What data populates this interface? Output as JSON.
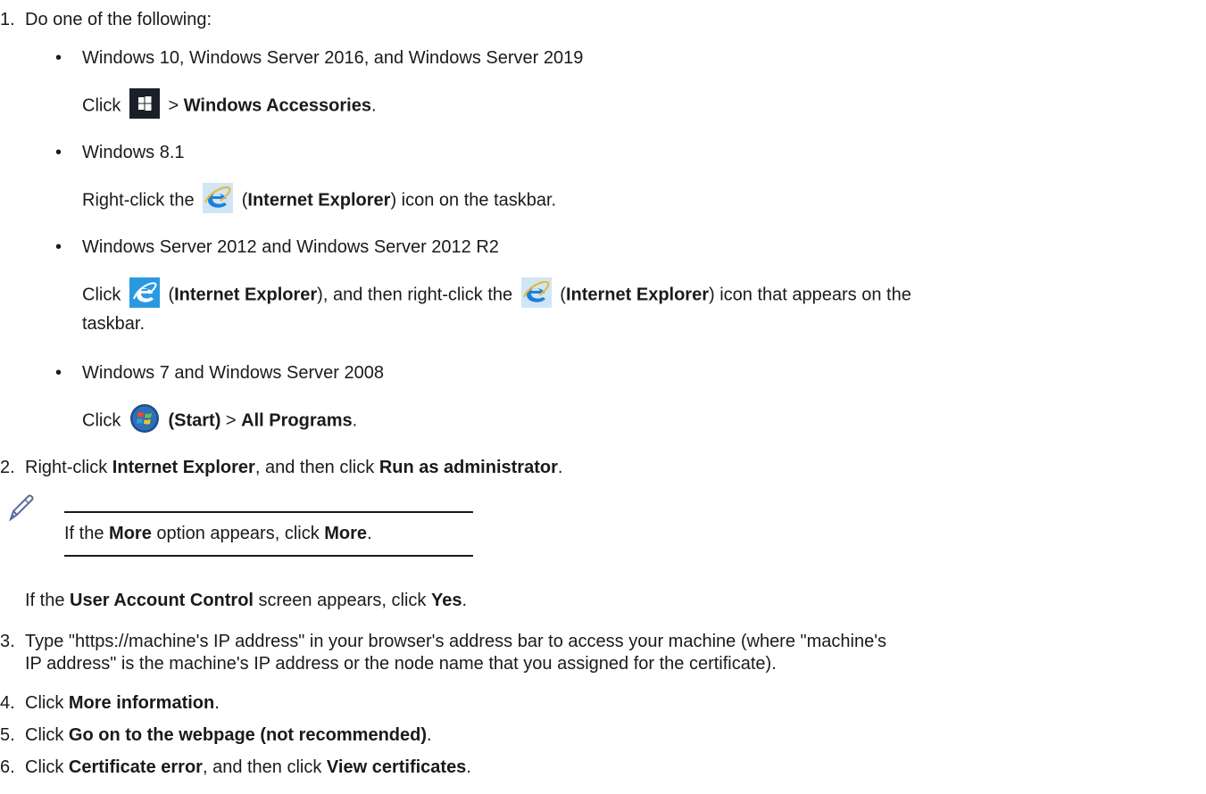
{
  "steps": {
    "s1": {
      "num": "1.",
      "text": "Do one of the following:"
    },
    "s2": {
      "num": "2.",
      "pre": "Right-click ",
      "b1": "Internet Explorer",
      "mid": ", and then click ",
      "b2": "Run as administrator",
      "post": "."
    },
    "s3": {
      "num": "3.",
      "line1": "Type \"https://machine's IP address\" in your browser's address bar to access your machine (where \"machine's",
      "line2": "IP address\" is the machine's IP address or the node name that you assigned for the certificate)."
    },
    "s4": {
      "num": "4.",
      "pre": "Click ",
      "b1": "More information",
      "post": "."
    },
    "s5": {
      "num": "5.",
      "pre": "Click ",
      "b1": "Go on to the webpage (not recommended)",
      "post": "."
    },
    "s6": {
      "num": "6.",
      "pre": "Click ",
      "b1": "Certificate error",
      "mid": ", and then click ",
      "b2": "View certificates",
      "post": "."
    }
  },
  "bullets": {
    "b1": {
      "mark": "•",
      "text": "Windows 10, Windows Server 2016, and Windows Server 2019",
      "click": "Click",
      "gt": " > ",
      "bold": "Windows Accessories",
      "post": "."
    },
    "b2": {
      "mark": "•",
      "text": "Windows 8.1",
      "pre": "Right-click the",
      "paren_open": " (",
      "bold": "Internet Explorer",
      "post": ") icon on the taskbar."
    },
    "b3": {
      "mark": "•",
      "text": "Windows Server 2012 and Windows Server 2012 R2",
      "click": "Click",
      "paren_open": " (",
      "bold1": "Internet Explorer",
      "mid": "), and then right-click the",
      "paren_open2": " (",
      "bold2": "Internet Explorer",
      "post": ") icon that appears on the",
      "post2": "taskbar."
    },
    "b4": {
      "mark": "•",
      "text": "Windows 7 and Windows Server 2008",
      "click": "Click",
      "bold1": "(Start)",
      "gt": " > ",
      "bold2": "All Programs",
      "post": "."
    }
  },
  "note": {
    "pre": "If the ",
    "b1": "More",
    "mid": " option appears, click ",
    "b2": "More",
    "post": "."
  },
  "uac": {
    "pre": "If the ",
    "b1": "User Account Control",
    "mid": " screen appears, click ",
    "b2": "Yes",
    "post": "."
  },
  "icons": {
    "windows": "windows-start-icon",
    "ie_flat": "internet-explorer-icon",
    "ie_tile": "internet-explorer-tile-icon",
    "win7": "windows-7-start-orb-icon",
    "note": "pencil-note-icon"
  },
  "colors": {
    "text": "#1a1a1a",
    "win_tile": "#1b1f2a",
    "ie_blue": "#1e7fd8",
    "ie_tile_bg": "#2a9ae0"
  }
}
